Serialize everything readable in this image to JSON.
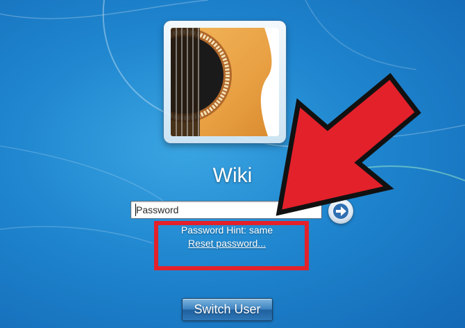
{
  "user": {
    "name": "Wiki",
    "avatar": "guitar-soundhole-photo"
  },
  "login": {
    "password_placeholder": "Password",
    "submit_icon": "arrow-right-icon"
  },
  "hint": {
    "text": "Password Hint: same",
    "reset_link": "Reset password..."
  },
  "footer": {
    "switch_user_label": "Switch User"
  },
  "annotations": {
    "highlight_color": "#e3212b",
    "arrow_color": "#e3212b"
  }
}
